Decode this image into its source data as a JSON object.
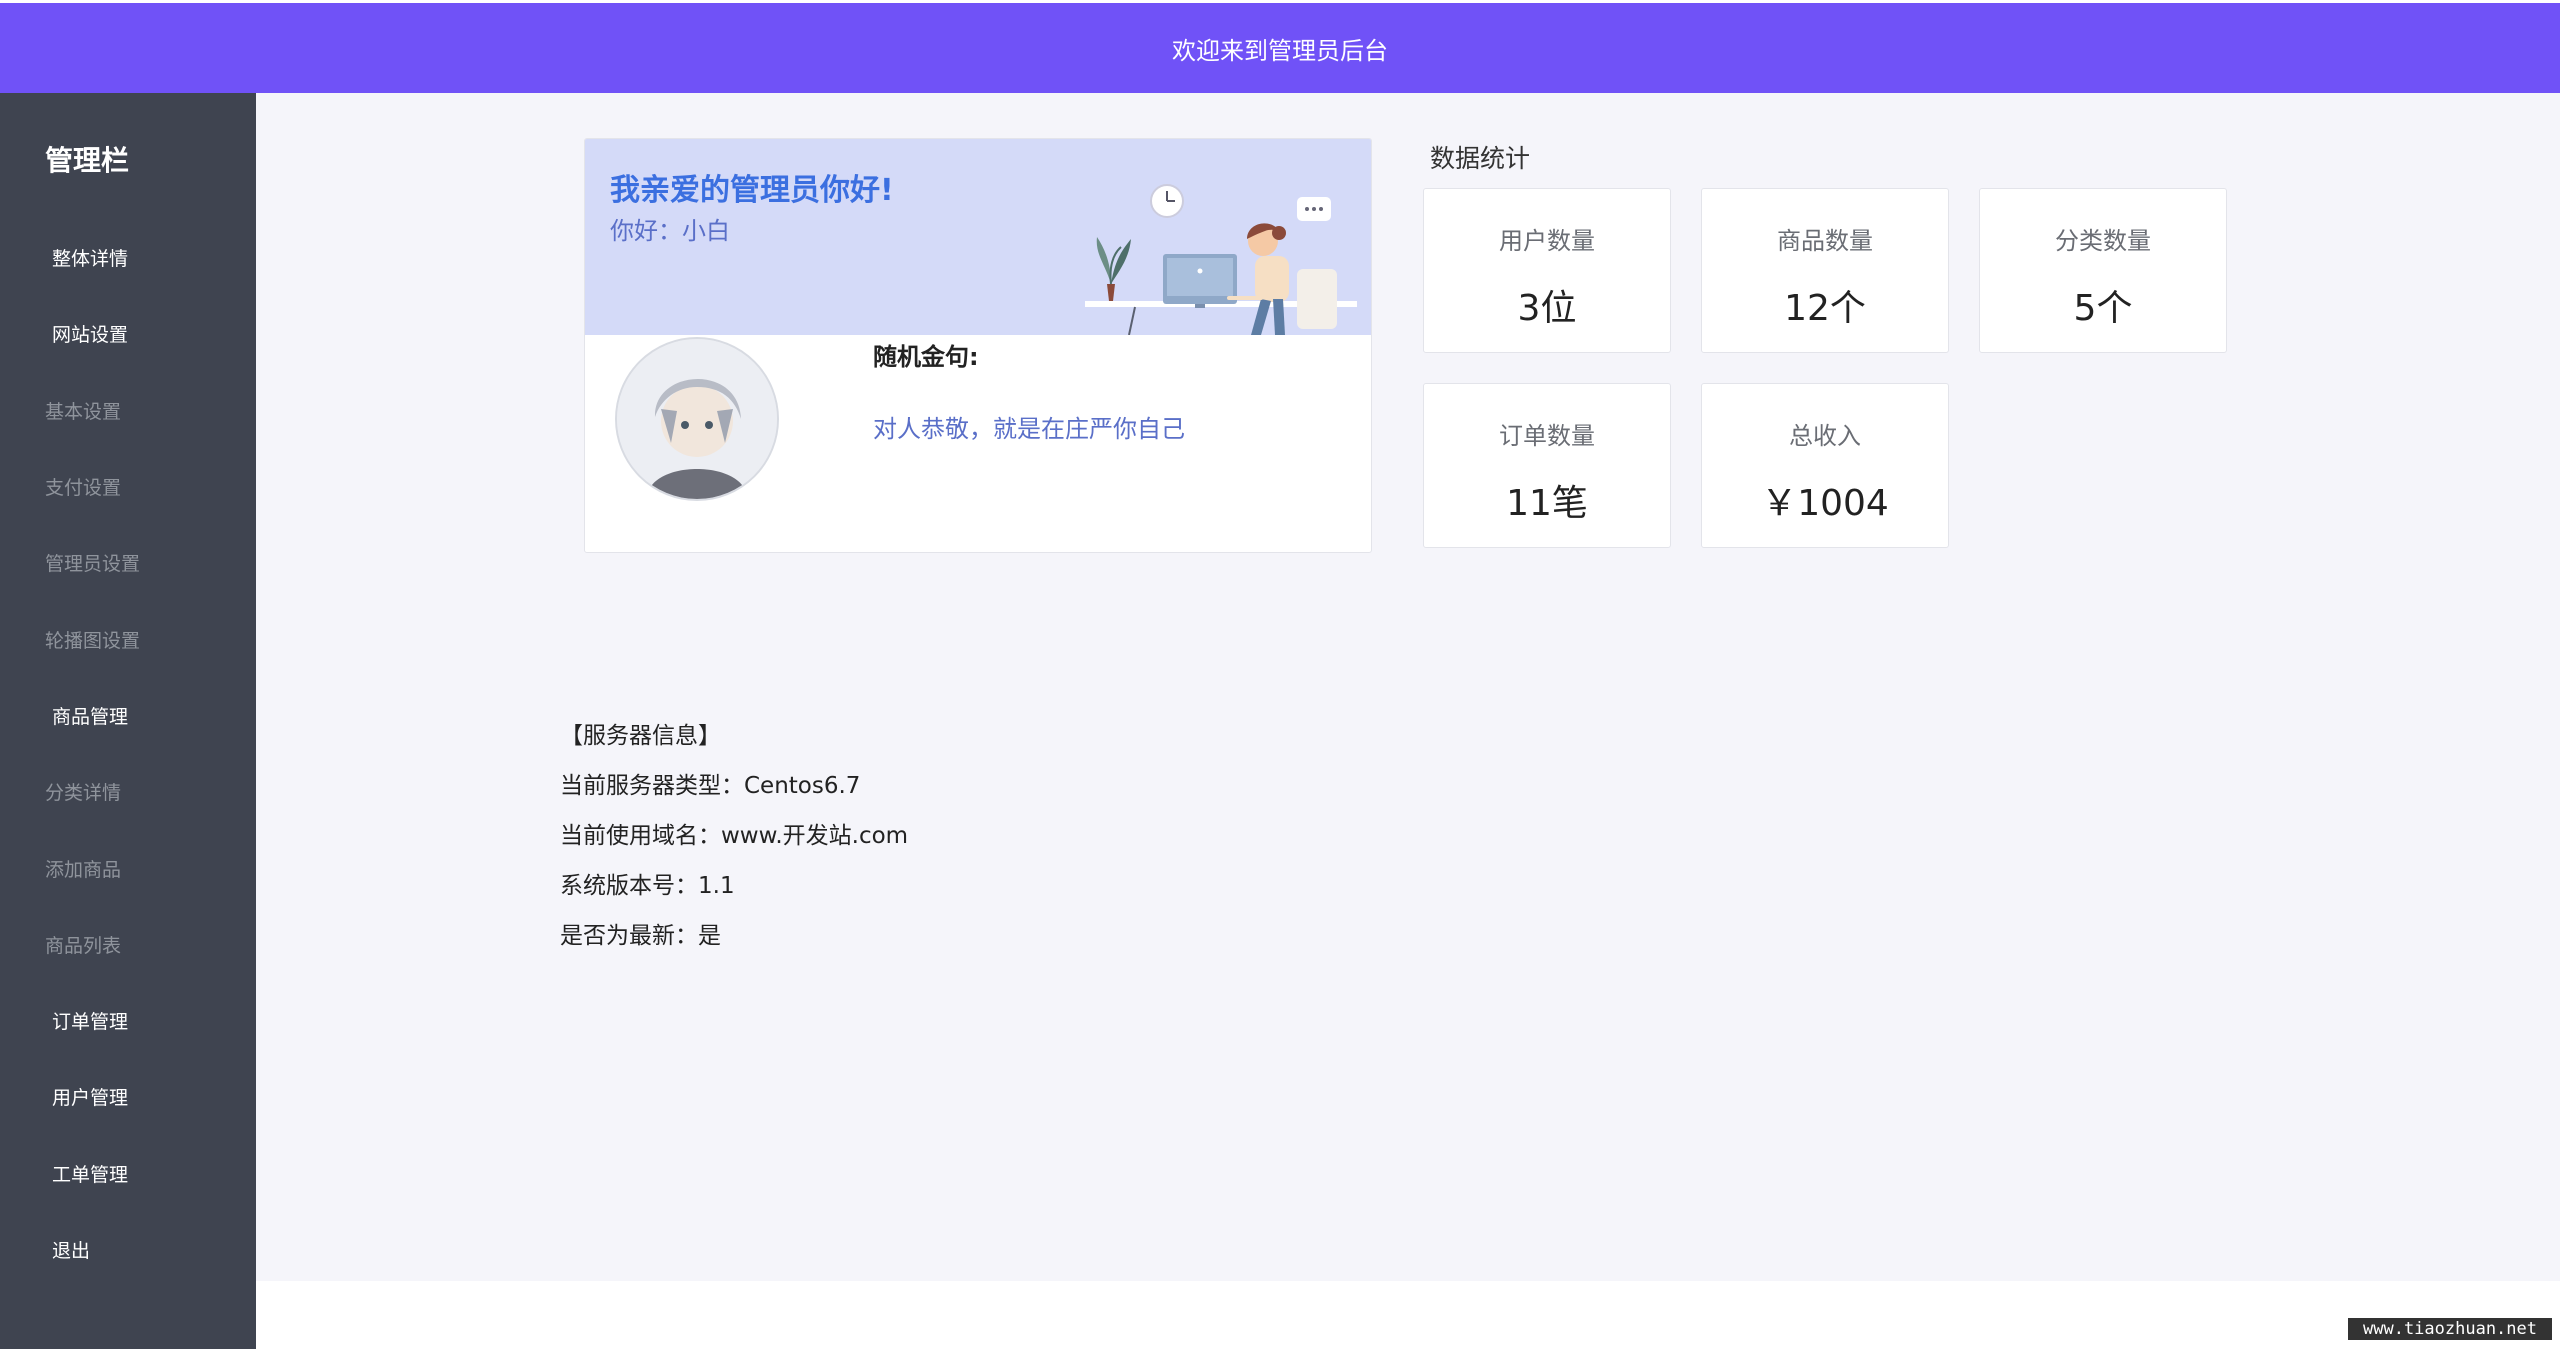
{
  "header": {
    "title": "欢迎来到管理员后台"
  },
  "sidebar": {
    "brand": "管理栏",
    "items": [
      {
        "label": "整体详情"
      },
      {
        "label": "网站设置"
      },
      {
        "label": "基本设置"
      },
      {
        "label": "支付设置"
      },
      {
        "label": "管理员设置"
      },
      {
        "label": "轮播图设置"
      },
      {
        "label": "商品管理"
      },
      {
        "label": "分类详情"
      },
      {
        "label": "添加商品"
      },
      {
        "label": "商品列表"
      },
      {
        "label": "订单管理"
      },
      {
        "label": "用户管理"
      },
      {
        "label": "工单管理"
      },
      {
        "label": "退出"
      }
    ]
  },
  "welcome": {
    "title": "我亲爱的管理员你好!",
    "greeting": "你好：小白",
    "quote_label": "随机金句:",
    "quote": "对人恭敬，就是在庄严你自己"
  },
  "stats": {
    "title": "数据统计",
    "cards": [
      {
        "label": "用户数量",
        "value": "3位"
      },
      {
        "label": "商品数量",
        "value": "12个"
      },
      {
        "label": "分类数量",
        "value": "5个"
      },
      {
        "label": "订单数量",
        "value": "11笔"
      },
      {
        "label": "总收入",
        "value": "￥1004"
      }
    ]
  },
  "server": {
    "heading": "【服务器信息】",
    "type": "当前服务器类型：Centos6.7",
    "domain": "当前使用域名：www.开发站.com",
    "version": "系统版本号：1.1",
    "latest": "是否为最新：是"
  },
  "watermark": "www.tiaozhuan.net",
  "colors": {
    "accent": "#7052f7",
    "sidebar": "#3f4450",
    "banner": "#d4daf8",
    "link": "#5a6fc8"
  }
}
